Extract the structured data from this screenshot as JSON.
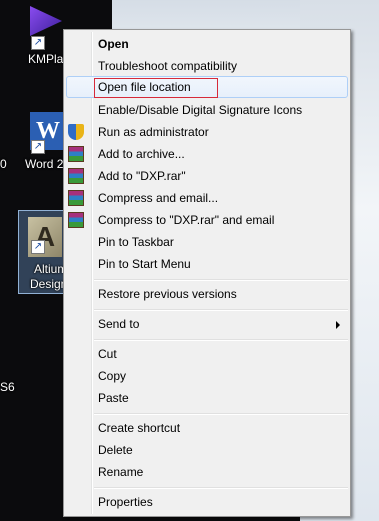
{
  "desktop": {
    "icons": [
      {
        "name": "kmplayer",
        "label": "KMPlay"
      },
      {
        "name": "word",
        "label": "Word 2",
        "left_cut_label": "0"
      },
      {
        "name": "altium",
        "label_line1": "Altium",
        "label_line2": "Design"
      }
    ],
    "side_text": "S6"
  },
  "context_menu": {
    "items": {
      "open": "Open",
      "troubleshoot": "Troubleshoot compatibility",
      "open_file_location": "Open file location",
      "digital_signature": "Enable/Disable Digital Signature Icons",
      "run_as_admin": "Run as administrator",
      "add_to_archive": "Add to archive...",
      "add_to_rar": "Add to \"DXP.rar\"",
      "compress_email": "Compress and email...",
      "compress_rar_email": "Compress to \"DXP.rar\" and email",
      "pin_taskbar": "Pin to Taskbar",
      "pin_start": "Pin to Start Menu",
      "restore_versions": "Restore previous versions",
      "send_to": "Send to",
      "cut": "Cut",
      "copy": "Copy",
      "paste": "Paste",
      "create_shortcut": "Create shortcut",
      "delete": "Delete",
      "rename": "Rename",
      "properties": "Properties"
    }
  }
}
